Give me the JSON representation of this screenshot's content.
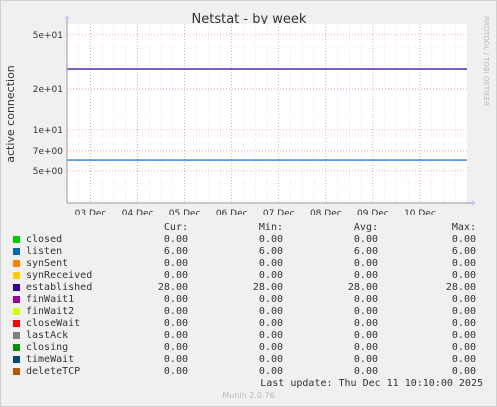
{
  "chart_data": {
    "type": "line",
    "title": "Netstat - by week",
    "ylabel": "active connection",
    "yscale": "log",
    "ylim": [
      2.9,
      60
    ],
    "yticks": [
      {
        "value": 50,
        "label": "5e+01"
      },
      {
        "value": 20,
        "label": "2e+01"
      },
      {
        "value": 10,
        "label": "1e+01"
      },
      {
        "value": 7,
        "label": "7e+00"
      },
      {
        "value": 5,
        "label": "5e+00"
      }
    ],
    "xticks": [
      "03 Dec",
      "04 Dec",
      "05 Dec",
      "06 Dec",
      "07 Dec",
      "08 Dec",
      "09 Dec",
      "10 Dec"
    ],
    "grid": true,
    "series": [
      {
        "name": "listen",
        "color": "#0066b3",
        "value": 6.0
      },
      {
        "name": "established",
        "color": "#330099",
        "value": 28.0
      }
    ]
  },
  "side_label": "RRDTOOL / TOBI OETIKER",
  "legend": {
    "headers": {
      "cur": "Cur:",
      "min": "Min:",
      "avg": "Avg:",
      "max": "Max:"
    },
    "rows": [
      {
        "name": "closed",
        "color": "#00cc00",
        "cur": "0.00",
        "min": "0.00",
        "avg": "0.00",
        "max": "0.00"
      },
      {
        "name": "listen",
        "color": "#0066b3",
        "cur": "6.00",
        "min": "6.00",
        "avg": "6.00",
        "max": "6.00"
      },
      {
        "name": "synSent",
        "color": "#ff8000",
        "cur": "0.00",
        "min": "0.00",
        "avg": "0.00",
        "max": "0.00"
      },
      {
        "name": "synReceived",
        "color": "#ffcc00",
        "cur": "0.00",
        "min": "0.00",
        "avg": "0.00",
        "max": "0.00"
      },
      {
        "name": "established",
        "color": "#330099",
        "cur": "28.00",
        "min": "28.00",
        "avg": "28.00",
        "max": "28.00"
      },
      {
        "name": "finWait1",
        "color": "#990099",
        "cur": "0.00",
        "min": "0.00",
        "avg": "0.00",
        "max": "0.00"
      },
      {
        "name": "finWait2",
        "color": "#ccff00",
        "cur": "0.00",
        "min": "0.00",
        "avg": "0.00",
        "max": "0.00"
      },
      {
        "name": "closeWait",
        "color": "#ff0000",
        "cur": "0.00",
        "min": "0.00",
        "avg": "0.00",
        "max": "0.00"
      },
      {
        "name": "lastAck",
        "color": "#808080",
        "cur": "0.00",
        "min": "0.00",
        "avg": "0.00",
        "max": "0.00"
      },
      {
        "name": "closing",
        "color": "#008f00",
        "cur": "0.00",
        "min": "0.00",
        "avg": "0.00",
        "max": "0.00"
      },
      {
        "name": "timeWait",
        "color": "#00487d",
        "cur": "0.00",
        "min": "0.00",
        "avg": "0.00",
        "max": "0.00"
      },
      {
        "name": "deleteTCP",
        "color": "#b35a00",
        "cur": "0.00",
        "min": "0.00",
        "avg": "0.00",
        "max": "0.00"
      }
    ]
  },
  "last_update": "Last update: Thu Dec 11 10:10:00 2025",
  "footer": "Munin 2.0.76"
}
